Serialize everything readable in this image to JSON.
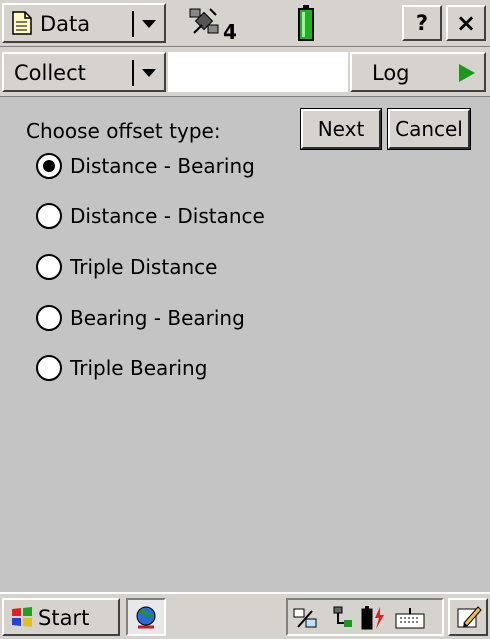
{
  "topbar": {
    "app_menu_label": "Data",
    "satellite_count": "4",
    "help_label": "?",
    "close_label": "×"
  },
  "menubar": {
    "mode_label": "Collect",
    "log_label": "Log"
  },
  "dialog": {
    "prompt": "Choose offset type:",
    "next_label": "Next",
    "cancel_label": "Cancel",
    "options": [
      {
        "label": "Distance - Bearing",
        "checked": true
      },
      {
        "label": "Distance - Distance",
        "checked": false
      },
      {
        "label": "Triple Distance",
        "checked": false
      },
      {
        "label": "Bearing - Bearing",
        "checked": false
      },
      {
        "label": "Triple Bearing",
        "checked": false
      }
    ]
  },
  "taskbar": {
    "start_label": "Start"
  },
  "colors": {
    "background": "#c4c4c4",
    "log_arrow": "#1a9a1a",
    "battery": "#22b022"
  }
}
